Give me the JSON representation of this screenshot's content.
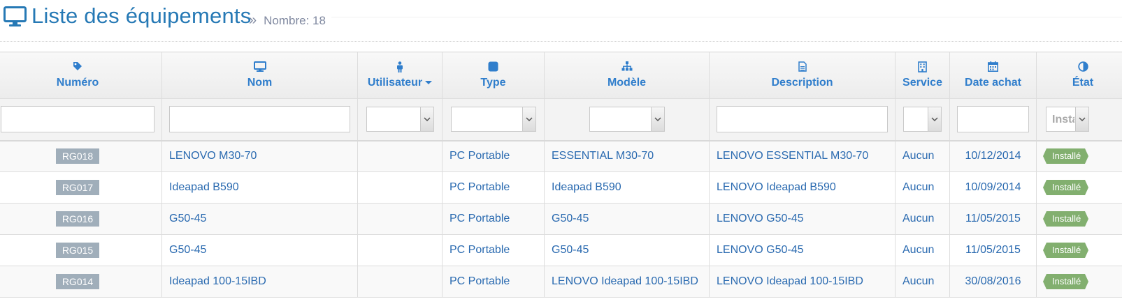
{
  "header": {
    "title": "Liste des équipements",
    "count_label": "Nombre: 18",
    "raquo": "»"
  },
  "columns": [
    {
      "label": "Numéro",
      "icon": "tag-icon"
    },
    {
      "label": "Nom",
      "icon": "desktop-icon"
    },
    {
      "label": "Utilisateur",
      "icon": "male-icon"
    },
    {
      "label": "Type",
      "icon": "stop-icon"
    },
    {
      "label": "Modèle",
      "icon": "sitemap-icon"
    },
    {
      "label": "Description",
      "icon": "file-text-icon"
    },
    {
      "label": "Service",
      "icon": "building-icon"
    },
    {
      "label": "Date achat",
      "icon": "calendar-icon"
    },
    {
      "label": "État",
      "icon": "adjust-icon"
    }
  ],
  "filters": {
    "etat_value": "Installé"
  },
  "rows": [
    {
      "numero": "RG018",
      "nom": "LENOVO M30-70",
      "utilisateur": "",
      "type": "PC Portable",
      "modele": "ESSENTIAL M30-70",
      "description": "LENOVO ESSENTIAL M30-70",
      "service": "Aucun",
      "date": "10/12/2014",
      "etat": "Installé"
    },
    {
      "numero": "RG017",
      "nom": "Ideapad B590",
      "utilisateur": "",
      "type": "PC Portable",
      "modele": "Ideapad B590",
      "description": "LENOVO Ideapad B590",
      "service": "Aucun",
      "date": "10/09/2014",
      "etat": "Installé"
    },
    {
      "numero": "RG016",
      "nom": "G50-45",
      "utilisateur": "",
      "type": "PC Portable",
      "modele": "G50-45",
      "description": "LENOVO G50-45",
      "service": "Aucun",
      "date": "11/05/2015",
      "etat": "Installé"
    },
    {
      "numero": "RG015",
      "nom": "G50-45",
      "utilisateur": "",
      "type": "PC Portable",
      "modele": "G50-45",
      "description": "LENOVO G50-45",
      "service": "Aucun",
      "date": "11/05/2015",
      "etat": "Installé"
    },
    {
      "numero": "RG014",
      "nom": "Ideapad 100-15IBD",
      "utilisateur": "",
      "type": "PC Portable",
      "modele": "LENOVO Ideapad 100-15IBD",
      "description": "LENOVO Ideapad 100-15IBD",
      "service": "Aucun",
      "date": "30/08/2016",
      "etat": "Installé"
    }
  ],
  "colors": {
    "primary": "#2679b5",
    "header_link": "#307ecc",
    "badge_grey": "#a0aeba",
    "badge_success": "#82af6f"
  }
}
